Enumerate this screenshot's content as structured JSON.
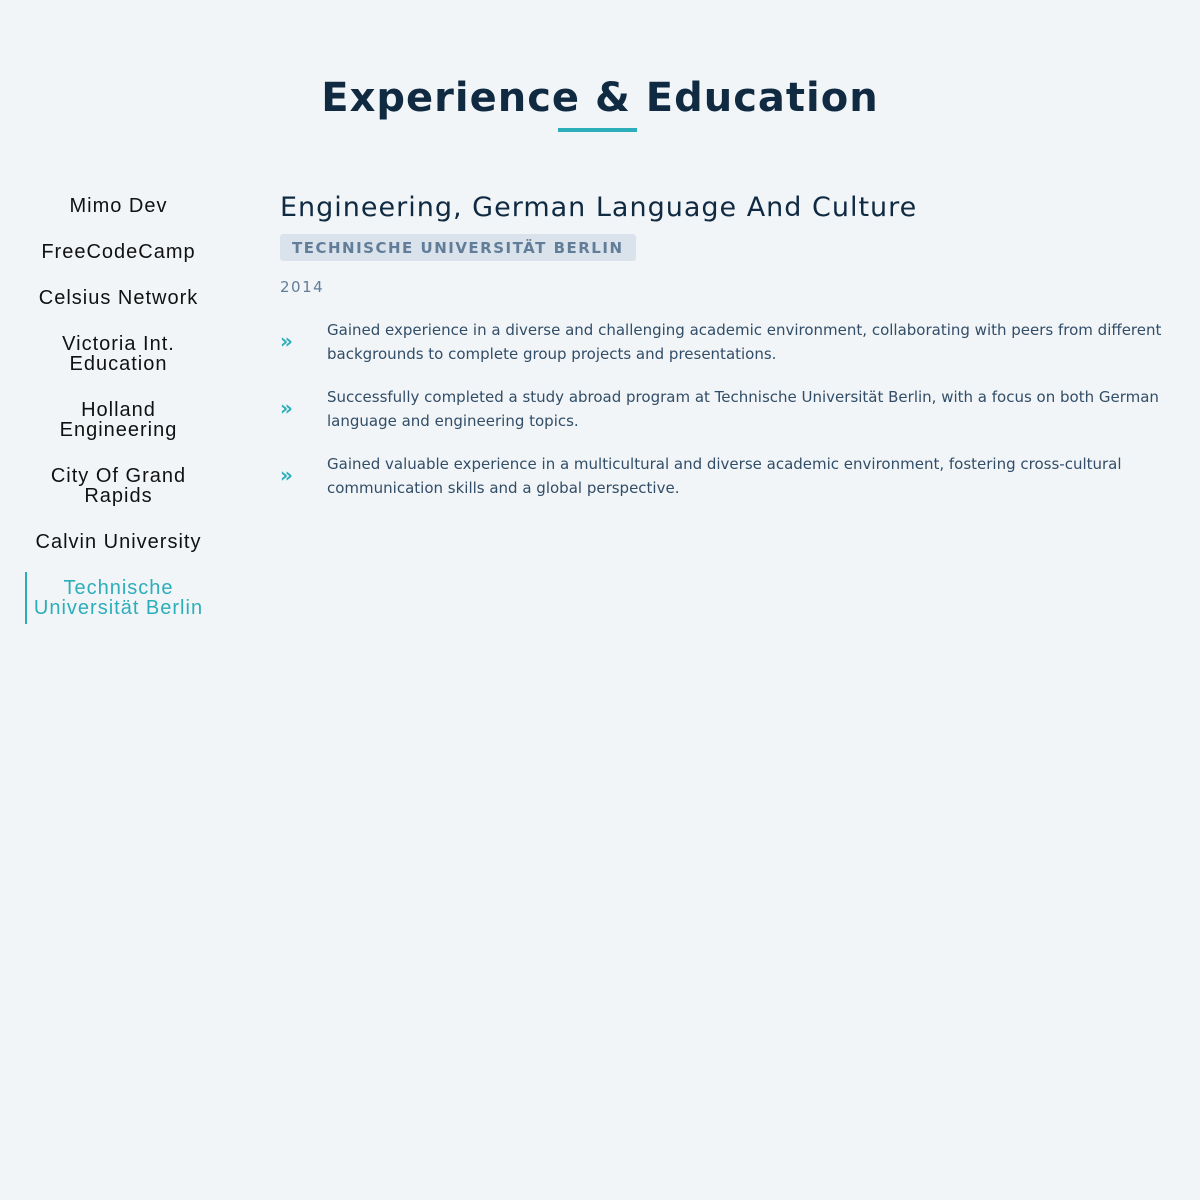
{
  "section": {
    "title": "Experience & Education"
  },
  "tabs": [
    {
      "label": "Mimo Dev",
      "active": false
    },
    {
      "label": "FreeCodeCamp",
      "active": false
    },
    {
      "label": "Celsius Network",
      "active": false
    },
    {
      "label": "Victoria Int. Education",
      "active": false
    },
    {
      "label": "Holland Engineering",
      "active": false
    },
    {
      "label": "City Of Grand Rapids",
      "active": false
    },
    {
      "label": "Calvin University",
      "active": false
    },
    {
      "label": "Technische Universität Berlin",
      "active": true
    }
  ],
  "job": {
    "title": "Engineering, German Language And Culture",
    "company": "TECHNISCHE UNIVERSITÄT BERLIN",
    "date": "2014",
    "duty_icon": "double-chevron-right-icon",
    "duties": [
      "Gained experience in a diverse and challenging academic environment, collaborating with peers from different backgrounds to complete group projects and presentations.",
      "Successfully completed a study abroad program at Technische Universität Berlin, with a focus on both German language and engineering topics.",
      "Gained valuable experience in a multicultural and diverse academic environment, fostering cross-cultural communication skills and a global perspective."
    ]
  },
  "colors": {
    "background": "#f1f5f8",
    "primary_dark": "#102a42",
    "accent": "#2caeba",
    "badge_bg": "#dae2ec",
    "badge_text": "#617d98",
    "body_text": "#324d67"
  }
}
